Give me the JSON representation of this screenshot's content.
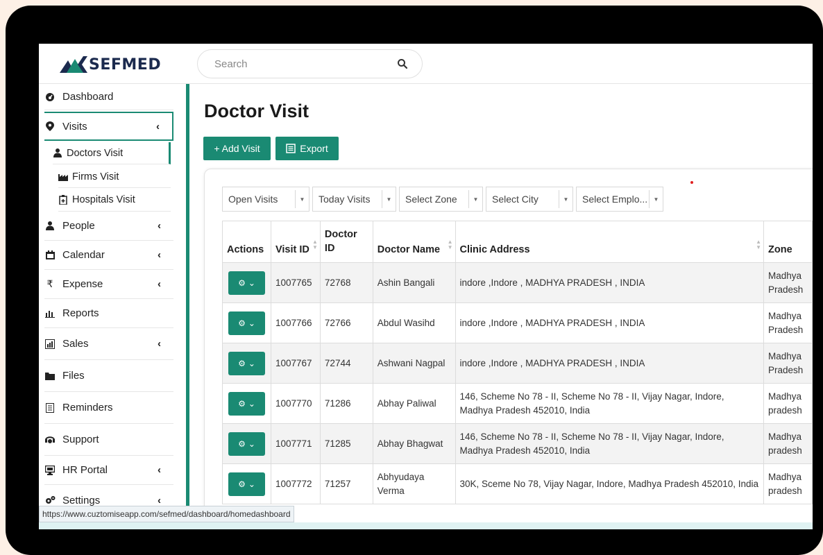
{
  "brand": {
    "name": "SEFMED"
  },
  "search": {
    "placeholder": "Search"
  },
  "sidebar": {
    "items": [
      {
        "label": "Dashboard",
        "icon": "dashboard-icon"
      },
      {
        "label": "Visits",
        "icon": "location-pin-icon",
        "chevron": "‹"
      },
      {
        "label": "Doctors Visit",
        "icon": "doctor-icon"
      },
      {
        "label": "Firms Visit",
        "icon": "factory-icon"
      },
      {
        "label": "Hospitals Visit",
        "icon": "hospital-icon"
      },
      {
        "label": "People",
        "icon": "person-icon",
        "chevron": "‹"
      },
      {
        "label": "Calendar",
        "icon": "calendar-icon",
        "chevron": "‹"
      },
      {
        "label": "Expense",
        "icon": "rupee-icon",
        "glyph": "₹",
        "chevron": "‹"
      },
      {
        "label": "Reports",
        "icon": "bar-chart-icon"
      },
      {
        "label": "Sales",
        "icon": "sales-chart-icon",
        "chevron": "‹"
      },
      {
        "label": "Files",
        "icon": "folder-icon"
      },
      {
        "label": "Reminders",
        "icon": "list-icon"
      },
      {
        "label": "Support",
        "icon": "support-icon"
      },
      {
        "label": "HR Portal",
        "icon": "monitor-icon",
        "chevron": "‹"
      },
      {
        "label": "Settings",
        "icon": "cogs-icon",
        "chevron": "‹"
      }
    ]
  },
  "main": {
    "title": "Doctor Visit",
    "add_button": "+ Add Visit",
    "export_button": "Export",
    "filters": [
      "Open Visits",
      "Today Visits",
      "Select Zone",
      "Select City",
      "Select Emplo..."
    ],
    "table": {
      "headers": [
        "Actions",
        "Visit ID",
        "Doctor ID",
        "Doctor Name",
        "Clinic Address",
        "Zone"
      ],
      "rows": [
        {
          "visit_id": "1007765",
          "doctor_id": "72768",
          "doctor_name": "Ashin Bangali",
          "address": "indore ,Indore , MADHYA PRADESH , INDIA",
          "zone": "Madhya Pradesh"
        },
        {
          "visit_id": "1007766",
          "doctor_id": "72766",
          "doctor_name": "Abdul Wasihd",
          "address": "indore ,Indore , MADHYA PRADESH , INDIA",
          "zone": "Madhya Pradesh"
        },
        {
          "visit_id": "1007767",
          "doctor_id": "72744",
          "doctor_name": "Ashwani Nagpal",
          "address": "indore ,Indore , MADHYA PRADESH , INDIA",
          "zone": "Madhya Pradesh"
        },
        {
          "visit_id": "1007770",
          "doctor_id": "71286",
          "doctor_name": "Abhay Paliwal",
          "address": "146, Scheme No 78 - II, Scheme No 78 - II, Vijay Nagar, Indore, Madhya Pradesh 452010, India",
          "zone": "Madhya pradesh"
        },
        {
          "visit_id": "1007771",
          "doctor_id": "71285",
          "doctor_name": "Abhay Bhagwat",
          "address": "146, Scheme No 78 - II, Scheme No 78 - II, Vijay Nagar, Indore, Madhya Pradesh 452010, India",
          "zone": "Madhya pradesh"
        },
        {
          "visit_id": "1007772",
          "doctor_id": "71257",
          "doctor_name": "Abhyudaya Verma",
          "address": "30K, Sceme No 78, Vijay Nagar, Indore, Madhya Pradesh 452010, India",
          "zone": "Madhya pradesh"
        }
      ]
    }
  },
  "status_url": "https://www.cuztomiseapp.com/sefmed/dashboard/homedashboard",
  "colors": {
    "accent": "#1a8a73",
    "link": "#2a79b6",
    "brand_text": "#1b2a4e"
  }
}
